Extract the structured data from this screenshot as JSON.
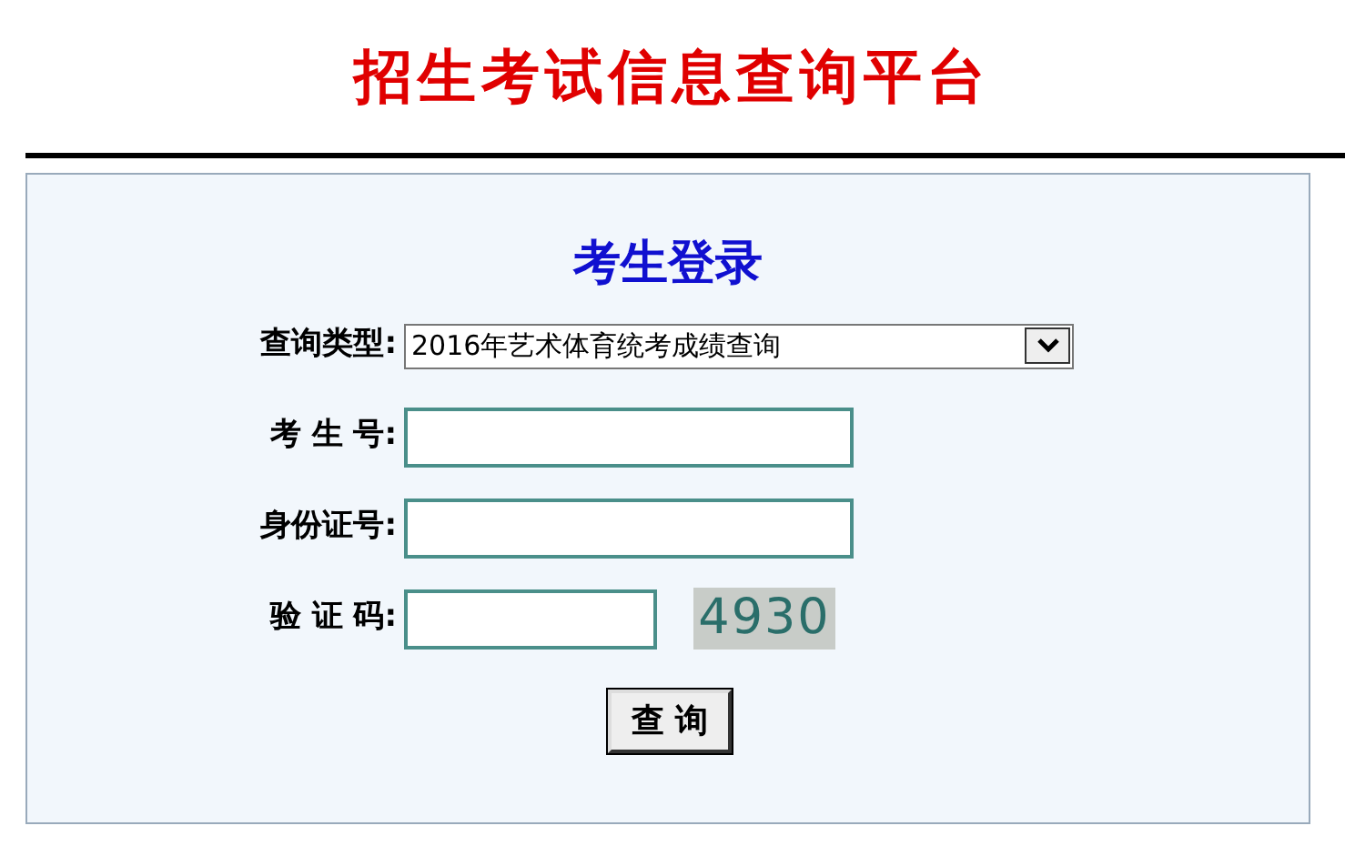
{
  "header": {
    "title": "招生考试信息查询平台"
  },
  "login": {
    "title": "考生登录",
    "fields": [
      {
        "kind": "select",
        "label": "查询类型:",
        "value": "2016年艺术体育统考成绩查询"
      },
      {
        "kind": "input",
        "label": "考 生 号:"
      },
      {
        "kind": "input",
        "label": "身份证号:"
      },
      {
        "kind": "captcha",
        "label": "验 证 码:",
        "code": "4930"
      }
    ],
    "button": "查 询"
  }
}
